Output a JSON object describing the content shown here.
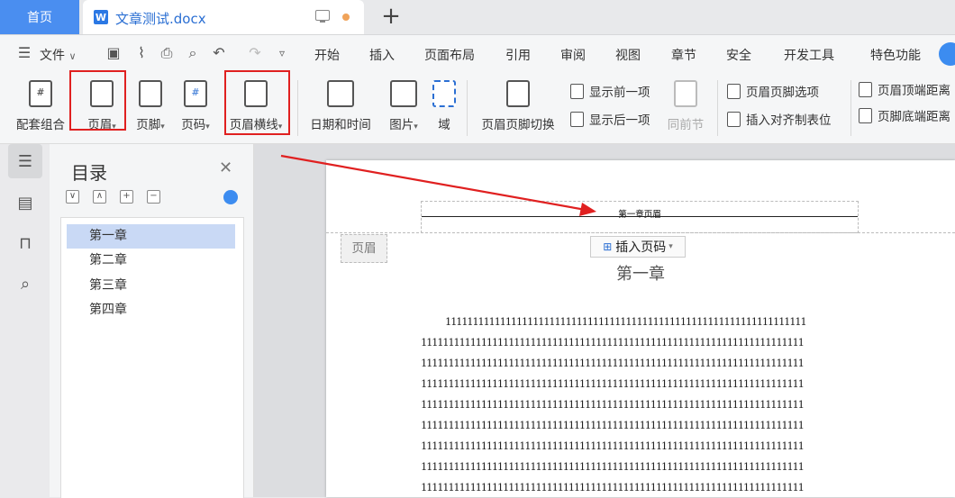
{
  "tabs": {
    "home": "首页",
    "doc_title": "文章测试.docx",
    "doc_icon": "W"
  },
  "menu": {
    "file": "文件",
    "items": [
      "开始",
      "插入",
      "页面布局",
      "引用",
      "审阅",
      "视图",
      "章节",
      "安全",
      "开发工具",
      "特色功能"
    ]
  },
  "ribbon": {
    "combo": "配套组合",
    "header": "页眉",
    "footer": "页脚",
    "page_number": "页码",
    "header_line": "页眉横线",
    "datetime": "日期和时间",
    "picture": "图片",
    "field": "域",
    "switch": "页眉页脚切换",
    "show_prev": "显示前一项",
    "show_next": "显示后一项",
    "same_as_prev": "同前节",
    "hf_options": "页眉页脚选项",
    "insert_align_tab": "插入对齐制表位",
    "header_top_dist": "页眉顶端距离",
    "footer_bottom_dist": "页脚底端距离"
  },
  "toc": {
    "title": "目录",
    "items": [
      "第一章",
      "第二章",
      "第三章",
      "第四章"
    ],
    "selected_index": 0
  },
  "document": {
    "header_text": "第一章页眉",
    "header_tag": "页眉",
    "insert_page_number": "插入页码",
    "chapter_title": "第一章",
    "lines": [
      "111111111111111111111111111111111111111111111111111111111111111111",
      "1111111111111111111111111111111111111111111111111111111111111111111111",
      "1111111111111111111111111111111111111111111111111111111111111111111111",
      "1111111111111111111111111111111111111111111111111111111111111111111111",
      "1111111111111111111111111111111111111111111111111111111111111111111111",
      "1111111111111111111111111111111111111111111111111111111111111111111111",
      "1111111111111111111111111111111111111111111111111111111111111111111111",
      "1111111111111111111111111111111111111111111111111111111111111111111111",
      "1111111111111111111111111111111111111111111111111111111111111111111111"
    ]
  },
  "colors": {
    "accent": "#4a8ef0",
    "highlight": "#e02020",
    "selected": "#c9d9f5"
  }
}
